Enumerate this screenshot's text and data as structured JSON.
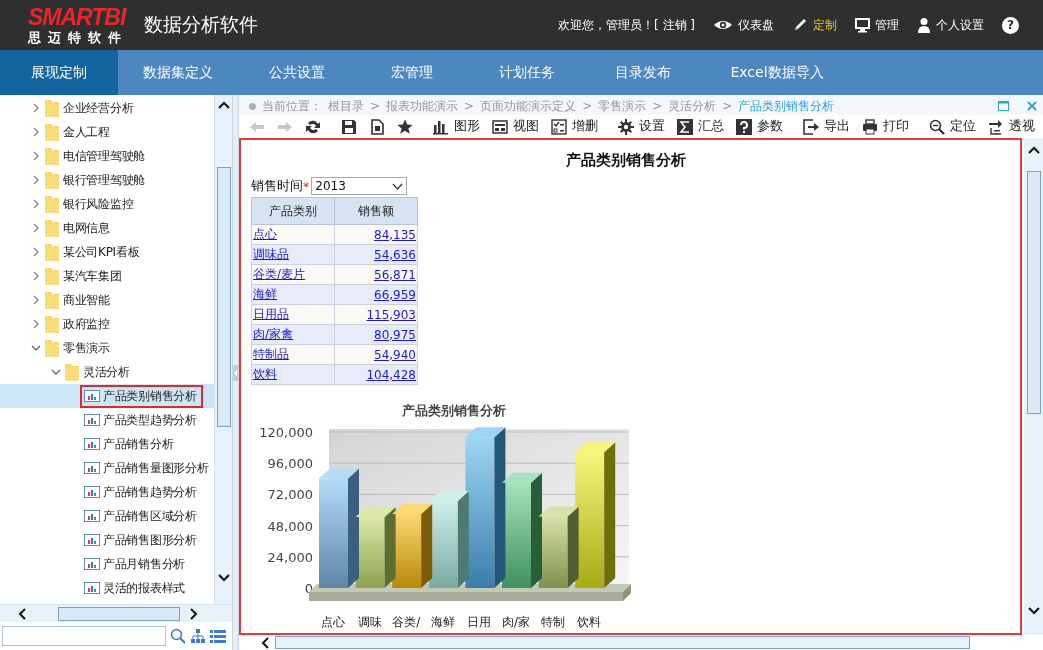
{
  "header": {
    "logo": "SMARTBI",
    "logo_sub": "思迈特软件",
    "app_title": "数据分析软件",
    "welcome": "欢迎您，管理员！[ ",
    "logout": "注销",
    "welcome_end": " ]",
    "menu": [
      {
        "label": "仪表盘",
        "selected": false
      },
      {
        "label": "定制",
        "selected": true
      },
      {
        "label": "管理",
        "selected": false
      },
      {
        "label": "个人设置",
        "selected": false
      }
    ],
    "help": "?"
  },
  "nav_tabs": [
    {
      "label": "展现定制",
      "selected": true
    },
    {
      "label": "数据集定义",
      "selected": false
    },
    {
      "label": "公共设置",
      "selected": false
    },
    {
      "label": "宏管理",
      "selected": false
    },
    {
      "label": "计划任务",
      "selected": false
    },
    {
      "label": "目录发布",
      "selected": false
    },
    {
      "label": "Excel数据导入",
      "selected": false
    }
  ],
  "tree": [
    {
      "label": "企业经营分析",
      "expanded": false
    },
    {
      "label": "金人工程",
      "expanded": false
    },
    {
      "label": "电信管理驾驶舱",
      "expanded": false
    },
    {
      "label": "银行管理驾驶舱",
      "expanded": false
    },
    {
      "label": "银行风险监控",
      "expanded": false
    },
    {
      "label": "电网信息",
      "expanded": false
    },
    {
      "label": "某公司KPI看板",
      "expanded": false
    },
    {
      "label": "某汽车集团",
      "expanded": false
    },
    {
      "label": "商业智能",
      "expanded": false
    },
    {
      "label": "政府监控",
      "expanded": false
    },
    {
      "label": "零售演示",
      "expanded": true,
      "children": [
        {
          "label": "灵活分析",
          "expanded": true,
          "children": [
            {
              "label": "产品类别销售分析",
              "selected": true
            },
            {
              "label": "产品类型趋势分析",
              "selected": false
            },
            {
              "label": "产品销售分析",
              "selected": false
            },
            {
              "label": "产品销售量图形分析",
              "selected": false
            },
            {
              "label": "产品销售趋势分析",
              "selected": false
            },
            {
              "label": "产品销售区域分析",
              "selected": false
            },
            {
              "label": "产品销售图形分析",
              "selected": false
            },
            {
              "label": "产品月销售分析",
              "selected": false
            },
            {
              "label": "灵活的报表样式",
              "selected": false
            }
          ]
        }
      ]
    }
  ],
  "breadcrumb": {
    "prefix": "当前位置：",
    "items": [
      {
        "kind": "link",
        "text": "根目录"
      },
      {
        "kind": "sep",
        "text": ">"
      },
      {
        "kind": "link",
        "text": "报表功能演示"
      },
      {
        "kind": "sep",
        "text": ">"
      },
      {
        "kind": "link",
        "text": "页面功能演示定义"
      },
      {
        "kind": "sep",
        "text": ">"
      },
      {
        "kind": "link",
        "text": "零售演示"
      },
      {
        "kind": "sep",
        "text": ">"
      },
      {
        "kind": "link",
        "text": "灵活分析"
      },
      {
        "kind": "sep",
        "text": ">"
      },
      {
        "kind": "current",
        "text": "产品类别销售分析"
      }
    ]
  },
  "toolbar": [
    {
      "disabled": true
    },
    {
      "disabled": true
    },
    {
      "disabled": false
    },
    {
      "disabled": false
    },
    {
      "disabled": false
    },
    {
      "disabled": false
    },
    {
      "label": "图形",
      "disabled": false
    },
    {
      "label": "视图",
      "disabled": false
    },
    {
      "label": "增删",
      "disabled": false
    },
    {
      "label": "设置",
      "disabled": false
    },
    {
      "label": "汇总",
      "disabled": false
    },
    {
      "label": "参数",
      "disabled": false
    },
    {
      "label": "导出",
      "disabled": false
    },
    {
      "label": "打印",
      "disabled": false
    },
    {
      "label": "定位",
      "disabled": false
    },
    {
      "label": "透视",
      "disabled": false
    }
  ],
  "report": {
    "title": "产品类别销售分析",
    "filter": {
      "label": "销售时间",
      "required": "*",
      "value": "2013"
    },
    "table": {
      "columns": [
        "产品类别",
        "销售额"
      ],
      "rows": [
        [
          "点心",
          "84,135"
        ],
        [
          "调味品",
          "54,636"
        ],
        [
          "谷类/麦片",
          "56,871"
        ],
        [
          "海鲜",
          "66,959"
        ],
        [
          "日用品",
          "115,903"
        ],
        [
          "肉/家禽",
          "80,975"
        ],
        [
          "特制品",
          "54,940"
        ],
        [
          "饮料",
          "104,428"
        ]
      ]
    },
    "chart": {
      "chart_data": {
        "type": "bar",
        "title": "产品类别销售分析",
        "categories": [
          "点心",
          "调味",
          "谷类/",
          "海鲜",
          "日用",
          "肉/家",
          "特制",
          "饮料"
        ],
        "series": [
          {
            "values": [
              84135,
              54636,
              56871,
              66959,
              115903,
              80975,
              54940,
              104428
            ]
          }
        ],
        "grid": true,
        "ylim": [
          0,
          120000
        ],
        "yticks": [
          {
            "value": 0,
            "label": "0"
          },
          {
            "value": 24000,
            "label": "24,000"
          },
          {
            "value": 48000,
            "label": "48,000"
          },
          {
            "value": 72000,
            "label": "72,000"
          },
          {
            "value": 96000,
            "label": "96,000"
          },
          {
            "value": 120000,
            "label": "120,000"
          }
        ]
      }
    }
  }
}
